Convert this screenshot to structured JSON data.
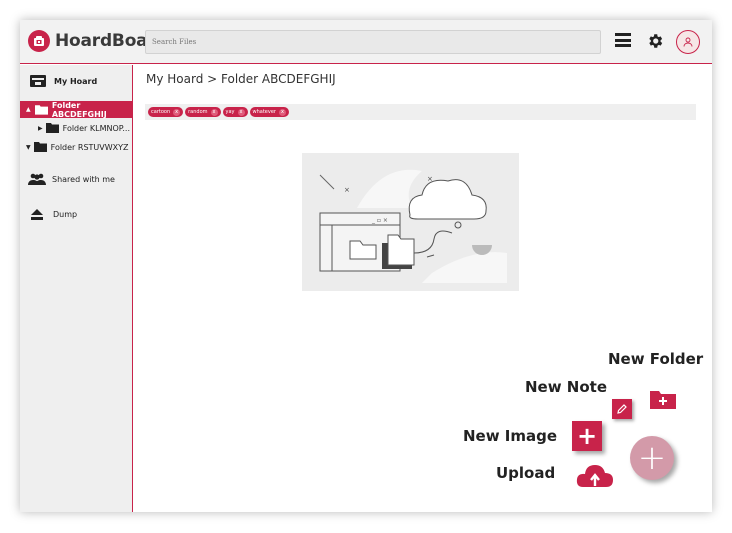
{
  "app": {
    "title": "HoardBoard",
    "accent_color": "#c8234a"
  },
  "header": {
    "search_placeholder": "Search Files",
    "menu_icon": "hamburger-menu-icon",
    "settings_icon": "gear-icon",
    "avatar_icon": "user-avatar-icon"
  },
  "sidebar": {
    "my_hoard": "My Hoard",
    "folders": [
      {
        "label": "Folder ABCDEFGHIJ",
        "active": true
      },
      {
        "label": "Folder KLMNOP...",
        "active": false
      },
      {
        "label": "Folder RSTUVWXYZ",
        "active": false
      }
    ],
    "shared": "Shared with me",
    "dump": "Dump"
  },
  "main": {
    "breadcrumb": "My Hoard > Folder ABCDEFGHIJ",
    "tags": [
      "cartoon",
      "random",
      "yay",
      "whatever"
    ],
    "tag_remove_symbol": "x"
  },
  "actions": {
    "new_folder": "New Folder",
    "new_note": "New Note",
    "new_image": "New Image",
    "upload": "Upload",
    "image_plus": "+",
    "main_plus": "+"
  }
}
